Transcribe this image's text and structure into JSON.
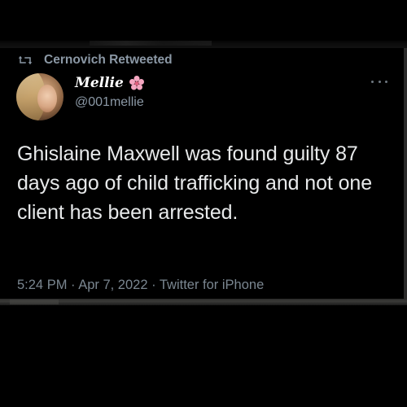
{
  "retweet": {
    "label": "Cernovich Retweeted"
  },
  "author": {
    "display_name": "Mellie",
    "emoji": "🌸",
    "handle": "@001mellie"
  },
  "tweet": {
    "text": "Ghislaine Maxwell was found guilty 87 days ago of child trafficking and not one client has been arrested."
  },
  "meta": {
    "time": "5:24 PM · Apr 7, 2022 · Twitter for iPhone"
  },
  "colors": {
    "background": "#000000",
    "text": "#e7e9ea",
    "secondary": "#8b98a5"
  }
}
